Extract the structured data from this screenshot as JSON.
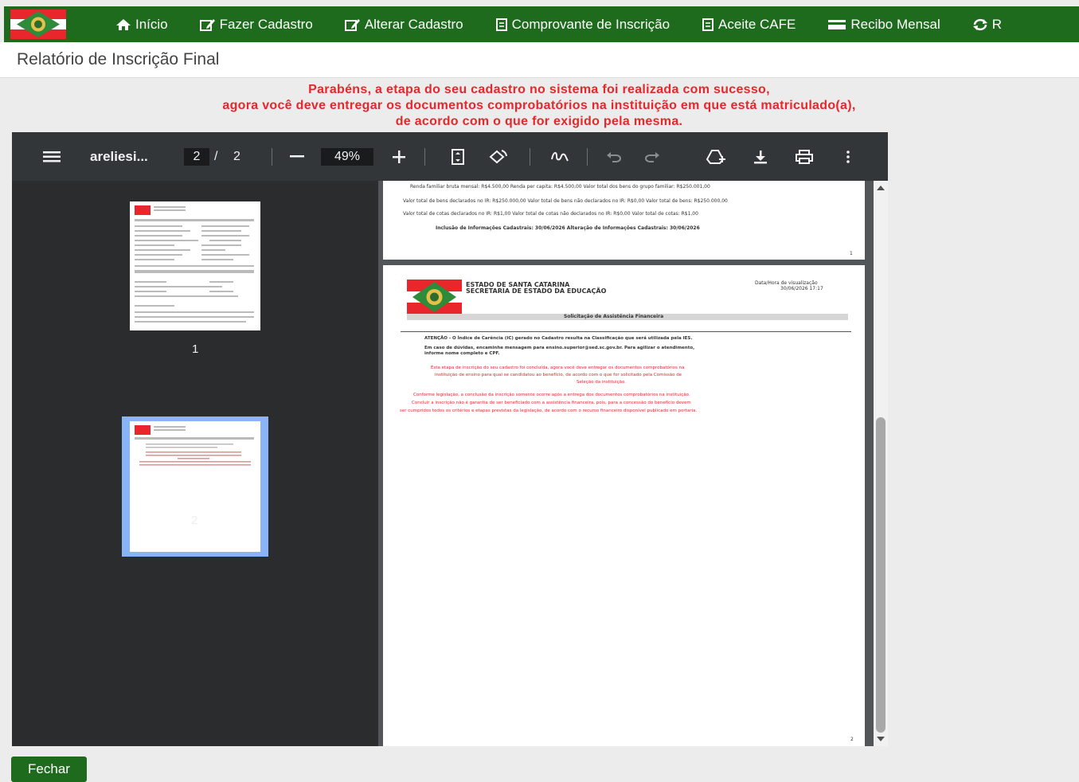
{
  "nav": {
    "items": [
      {
        "label": "Início",
        "icon": "home-icon"
      },
      {
        "label": "Fazer Cadastro",
        "icon": "edit-icon"
      },
      {
        "label": "Alterar Cadastro",
        "icon": "edit-icon"
      },
      {
        "label": "Comprovante de Inscrição",
        "icon": "document-icon"
      },
      {
        "label": "Aceite CAFE",
        "icon": "document-icon"
      },
      {
        "label": "Recibo Mensal",
        "icon": "card-icon"
      },
      {
        "label": "R",
        "icon": "refresh-icon"
      }
    ],
    "color": "#1e6b1e"
  },
  "page": {
    "title": "Relatório de Inscrição Final"
  },
  "message": {
    "line1": "Parabéns, a etapa do seu cadastro no sistema foi realizada com sucesso,",
    "line2": "agora você deve entregar os documentos comprobatórios na instituição em que está matriculado(a),",
    "line3": "de acordo com o que for exigido pela mesma.",
    "color": "#e8262b"
  },
  "viewer": {
    "filename": "areliesi...",
    "current_page": "2",
    "page_separator": "/",
    "total_pages": "2",
    "zoom": "49%",
    "thumb_labels": [
      "1",
      "2"
    ]
  },
  "doc": {
    "p1_rows": [
      "Renda familiar bruta mensal:   R$4.500,00          Renda per capita:   R$4.500,00          Valor total dos bens do grupo familiar:   R$250.001,00",
      "Valor total de bens declarados no IR:   R$250.000,00          Valor total de bens não declarados no IR:   R$0,00          Valor total de bens:   R$250.000,00",
      "Valor total de cotas declarados no IR:   R$1,00          Valor total de cotas não declarados no IR:   R$0,00          Valor total de cotas:   R$1,00",
      "Inclusão de Informações Cadastrais:   30/06/2026                    Alteração de Informações Cadastrais:   30/06/2026"
    ],
    "p1_pagenum": "1",
    "header_state": "ESTADO DE SANTA CATARINA",
    "header_dept": "SECRETARIA DE ESTADO DA EDUCAÇÃO",
    "date_label": "Data/Hora de visualização",
    "date_value": "30/06/2026 17:17",
    "section_title": "Solicitação de Assistência Financeira",
    "attention": "ATENÇÃO - O Índice de Carência (IC) gerado no Cadastro resulta na Classificação que será utilizada pela IES.",
    "contact1": "Em caso de dúvidas, encaminhe mensagem para ensino.superior@sed.sc.gov.br. Para agilizar o atendimento,",
    "contact2": "informe nome completo e CPF.",
    "red1": "Esta etapa de inscrição do seu cadastro foi concluída, agora você deve entregar os documentos comprobatórios na",
    "red2": "instituição de ensino para qual se candidatou ao benefício, de acordo com o que for solicitado pela Comissão de",
    "red3": "Seleção da instituição.",
    "red4": "Conforme legislação, a conclusão da inscrição somente ocorre após a entrega dos documentos comprobatórios na instituição.",
    "red5": "Concluir a inscrição não é garantia de ser beneficiado com a assistência financeira, pois, para a concessão do benefício devem",
    "red6": "ser cumpridos todos os critérios e etapas previstas da legislação, de acordo com o recurso financeiro disponível publicado em portaria.",
    "p2_pagenum": "2"
  },
  "footer": {
    "close_label": "Fechar"
  }
}
